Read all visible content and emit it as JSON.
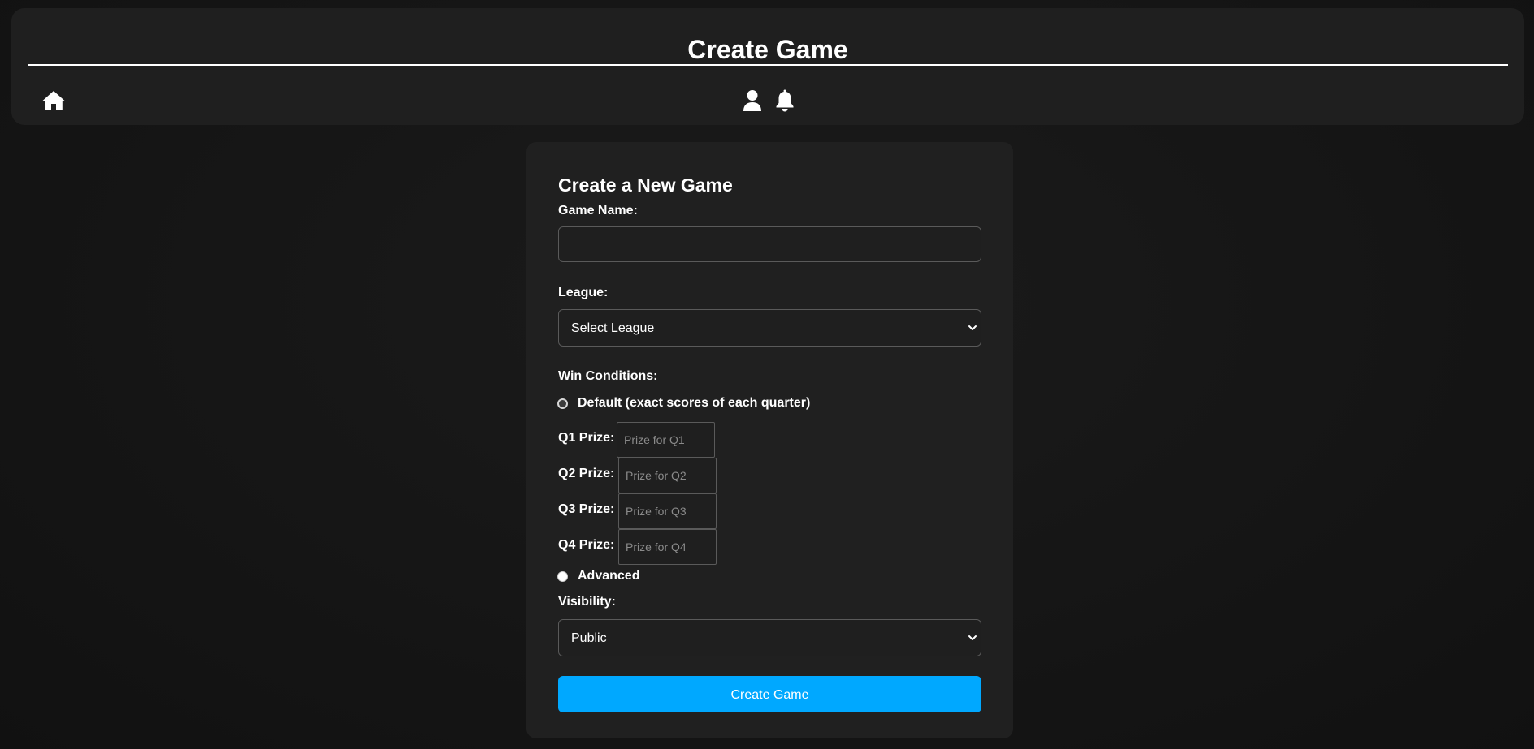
{
  "header": {
    "title": "Create Game",
    "icons": {
      "home": "home-icon",
      "profile": "user-icon",
      "notifications": "bell-icon"
    }
  },
  "form": {
    "heading": "Create a New Game",
    "game_name": {
      "label": "Game Name:",
      "value": "",
      "placeholder": ""
    },
    "league": {
      "label": "League:",
      "selected": "Select League"
    },
    "win_conditions": {
      "label": "Win Conditions:",
      "options": [
        {
          "label": "Default (exact scores of each quarter)",
          "checked": false
        },
        {
          "label": "Advanced",
          "checked": false
        }
      ],
      "prizes": [
        {
          "label": "Q1 Prize:",
          "placeholder": "Prize for Q1",
          "value": ""
        },
        {
          "label": "Q2 Prize:",
          "placeholder": "Prize for Q2",
          "value": ""
        },
        {
          "label": "Q3 Prize:",
          "placeholder": "Prize for Q3",
          "value": ""
        },
        {
          "label": "Q4 Prize:",
          "placeholder": "Prize for Q4",
          "value": ""
        }
      ]
    },
    "visibility": {
      "label": "Visibility:",
      "selected": "Public"
    },
    "submit_label": "Create Game"
  },
  "colors": {
    "background": "#151515",
    "panel": "#1f1f1f",
    "accent": "#00a8ff",
    "text": "#ffffff",
    "border": "#5a5a5a"
  }
}
